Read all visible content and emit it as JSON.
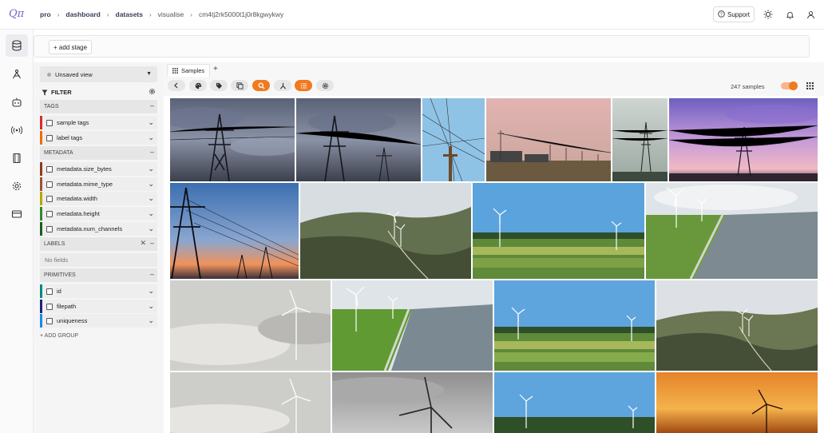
{
  "brand": {
    "logo_text": "Qπ"
  },
  "breadcrumbs": [
    "pro",
    "dashboard",
    "datasets",
    "visualise",
    "cm4tj2rk5000t1j0r8kgwykwy"
  ],
  "topbar": {
    "support_label": "Support"
  },
  "rail": {
    "items": [
      "database-icon",
      "annotate-icon",
      "robot-icon",
      "broadcast-icon",
      "film-icon",
      "settings-icon",
      "card-icon"
    ]
  },
  "stage": {
    "add_label": "+ add stage"
  },
  "sidebar": {
    "view_label": "Unsaved view",
    "filter_label": "FILTER",
    "groups": {
      "tags": {
        "label": "TAGS",
        "items": [
          {
            "label": "sample tags",
            "color": "#d32f2f"
          },
          {
            "label": "label tags",
            "color": "#ef6c00"
          }
        ]
      },
      "metadata": {
        "label": "METADATA",
        "items": [
          {
            "label": "metadata.size_bytes",
            "color": "#8d3b1f"
          },
          {
            "label": "metadata.mime_type",
            "color": "#a0522d"
          },
          {
            "label": "metadata.width",
            "color": "#b5a600"
          },
          {
            "label": "metadata.height",
            "color": "#2e8b2e"
          },
          {
            "label": "metadata.num_channels",
            "color": "#1b5e20"
          }
        ]
      },
      "labels": {
        "label": "LABELS",
        "empty_text": "No fields"
      },
      "primitives": {
        "label": "PRIMITIVES",
        "items": [
          {
            "label": "id",
            "color": "#00897b"
          },
          {
            "label": "filepath",
            "color": "#1a237e"
          },
          {
            "label": "uniqueness",
            "color": "#1e88e5"
          }
        ]
      }
    },
    "add_group_label": "+ ADD GROUP"
  },
  "tabs": {
    "samples_label": "Samples",
    "add_label": "+"
  },
  "toolbar": {
    "sample_count": "247 samples",
    "accent_color": "#f07a20"
  },
  "gallery": {
    "rows": [
      [
        "pylon-storm-1",
        "pylon-storm-2",
        "power-lines-sky",
        "substation-dusk",
        "pylon-haze",
        "pylon-purple-sky"
      ],
      [
        "pylon-sunset",
        "wind-farm-hills",
        "wind-turbines-meadow",
        "wind-turbines-shore"
      ],
      [
        "turbine-fog",
        "wind-turbines-shore-2",
        "wind-turbines-meadow-2",
        "wind-farm-hills-2"
      ],
      [
        "turbine-fog-2",
        "turbine-gray-sky",
        "wind-turbines-meadow-3",
        "turbine-orange-sunset"
      ]
    ]
  }
}
